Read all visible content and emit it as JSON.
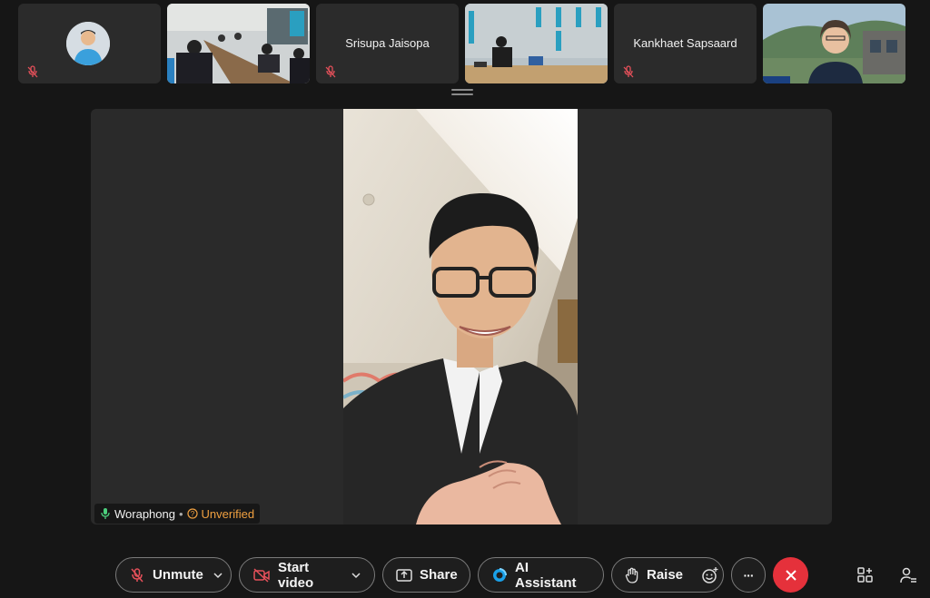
{
  "thumbnails": [
    {
      "type": "avatar",
      "name": ""
    },
    {
      "type": "video-classroom",
      "name": ""
    },
    {
      "type": "name-only",
      "name": "Srisupa Jaisopa"
    },
    {
      "type": "video-room",
      "name": ""
    },
    {
      "type": "name-only",
      "name": "Kankhaet Sapsaard"
    },
    {
      "type": "video-person",
      "name": ""
    }
  ],
  "speaker": {
    "name": "Woraphong",
    "separator": "•",
    "status": "Unverified"
  },
  "controls": {
    "unmute": "Unmute",
    "start_video": "Start video",
    "share": "Share",
    "ai_assistant": "AI Assistant",
    "raise": "Raise",
    "more": "···"
  },
  "colors": {
    "background": "#161616",
    "tile": "#2a2a2a",
    "end_call": "#e5313b",
    "mic_off": "#e5505a",
    "unverified": "#f0a040",
    "mic_active": "#4cd07d"
  }
}
